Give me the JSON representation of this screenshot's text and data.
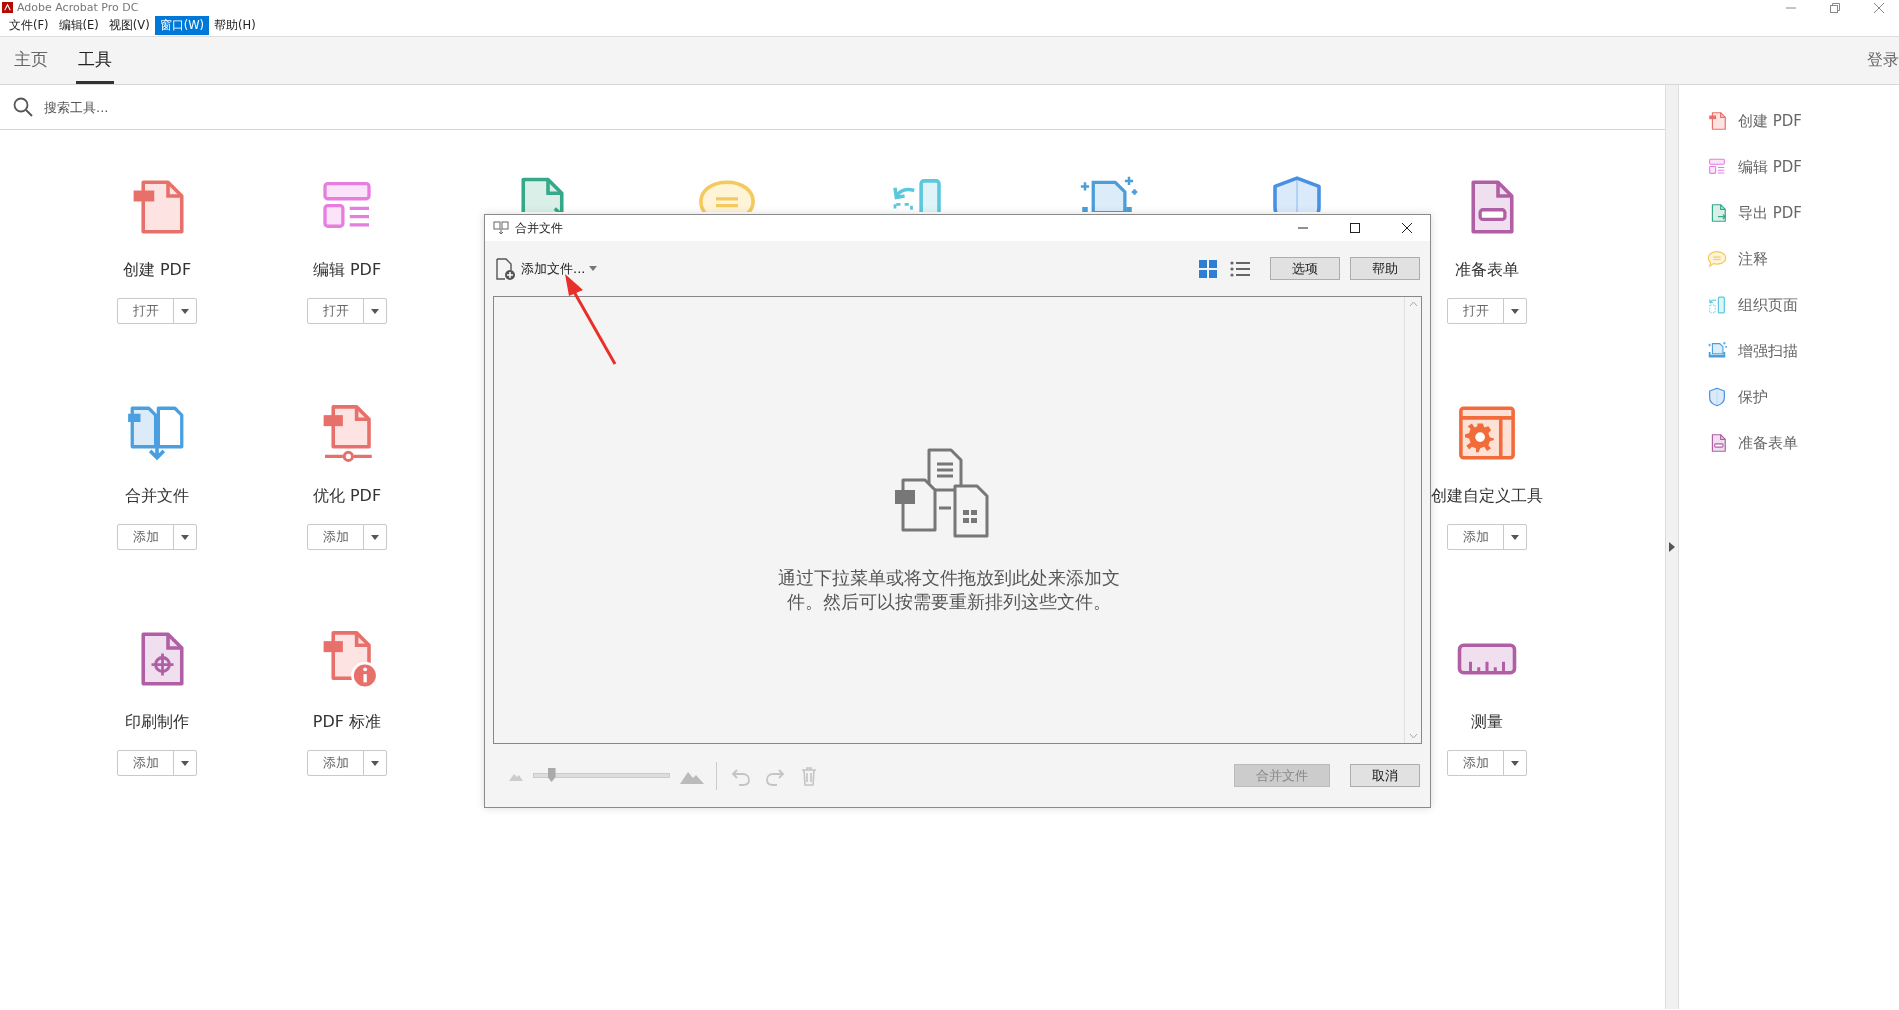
{
  "window": {
    "title": "Adobe Acrobat Pro DC"
  },
  "menu": [
    {
      "label": "文件(F)",
      "selected": false
    },
    {
      "label": "编辑(E)",
      "selected": false
    },
    {
      "label": "视图(V)",
      "selected": false
    },
    {
      "label": "窗口(W)",
      "selected": true
    },
    {
      "label": "帮助(H)",
      "selected": false
    }
  ],
  "tabs": [
    {
      "label": "主页",
      "selected": false
    },
    {
      "label": "工具",
      "selected": true
    }
  ],
  "sign_in": "登录",
  "search": {
    "placeholder": "搜索工具..."
  },
  "tool_rows": [
    [
      {
        "kind": "create",
        "label": "创建 PDF",
        "button": "打开"
      },
      {
        "kind": "edit",
        "label": "编辑 PDF",
        "button": "打开"
      },
      {
        "kind": "export"
      },
      {
        "kind": "comment"
      },
      {
        "kind": "organize"
      },
      {
        "kind": "scan"
      },
      {
        "kind": "protect"
      },
      {
        "kind": "form",
        "label": "准备表单",
        "button": "打开"
      }
    ],
    [
      {
        "kind": "combine",
        "label": "合并文件",
        "button": "添加"
      },
      {
        "kind": "optimize",
        "label": "优化 PDF",
        "button": "添加"
      },
      {
        "kind": "blank"
      },
      {
        "kind": "blank"
      },
      {
        "kind": "blank"
      },
      {
        "kind": "blank"
      },
      {
        "kind": "blank"
      },
      {
        "kind": "custom",
        "label": "创建自定义工具",
        "button": "添加"
      }
    ],
    [
      {
        "kind": "print",
        "label": "印刷制作",
        "button": "添加"
      },
      {
        "kind": "standards",
        "label": "PDF 标准",
        "button": "添加"
      },
      {
        "kind": "blank"
      },
      {
        "kind": "blank"
      },
      {
        "kind": "blank"
      },
      {
        "kind": "blank"
      },
      {
        "kind": "blank"
      },
      {
        "kind": "measure",
        "label": "测量",
        "button": "添加"
      }
    ]
  ],
  "sidebar": {
    "items": [
      {
        "kind": "create",
        "label": "创建 PDF"
      },
      {
        "kind": "edit",
        "label": "编辑 PDF"
      },
      {
        "kind": "export",
        "label": "导出 PDF"
      },
      {
        "kind": "comment",
        "label": "注释"
      },
      {
        "kind": "organize",
        "label": "组织页面"
      },
      {
        "kind": "scan",
        "label": "增强扫描"
      },
      {
        "kind": "protect",
        "label": "保护"
      },
      {
        "kind": "form",
        "label": "准备表单"
      }
    ]
  },
  "dialog": {
    "title": "合并文件",
    "add_files": "添加文件...",
    "views": [
      {
        "kind": "grid",
        "selected": true
      },
      {
        "kind": "list",
        "selected": false
      }
    ],
    "buttons": [
      "选项",
      "帮助"
    ],
    "hint": "通过下拉菜单或将文件拖放到此处来添加文件。然后可以按需要重新排列这些文件。",
    "zoom": {
      "level": 0.13
    },
    "actions": [
      {
        "kind": "undo",
        "disabled": true
      },
      {
        "kind": "redo",
        "disabled": true
      },
      {
        "kind": "delete",
        "disabled": true
      }
    ],
    "footer_buttons": [
      {
        "label": "合并文件",
        "disabled": true
      },
      {
        "label": "取消",
        "disabled": false
      }
    ]
  }
}
